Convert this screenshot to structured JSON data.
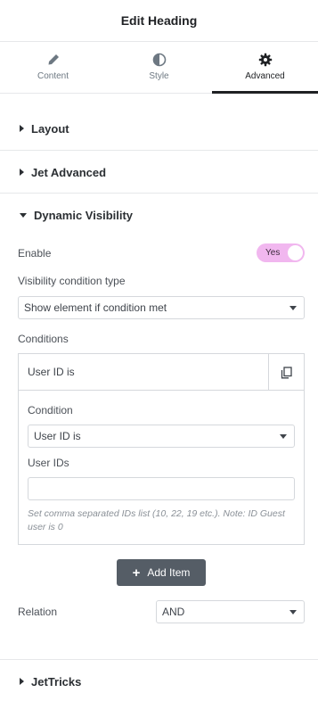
{
  "header": {
    "title": "Edit Heading"
  },
  "tabs": [
    {
      "label": "Content",
      "icon": "pencil-icon"
    },
    {
      "label": "Style",
      "icon": "half-circle-icon"
    },
    {
      "label": "Advanced",
      "icon": "gear-icon",
      "active": true
    }
  ],
  "sections": {
    "layout": "Layout",
    "jet_advanced": "Jet Advanced",
    "dynamic_visibility": "Dynamic Visibility",
    "jettricks": "JetTricks"
  },
  "dynamic_visibility": {
    "enable_label": "Enable",
    "enable_value": "Yes",
    "condition_type_label": "Visibility condition type",
    "condition_type_value": "Show element if condition met",
    "conditions_label": "Conditions",
    "item": {
      "title": "User ID is",
      "condition_label": "Condition",
      "condition_value": "User ID is",
      "user_ids_label": "User IDs",
      "user_ids_value": "",
      "description": "Set comma separated IDs list (10, 22, 19 etc.). Note: ID Guest user is 0"
    },
    "add_item_label": "Add Item",
    "relation_label": "Relation",
    "relation_value": "AND"
  },
  "colors": {
    "toggle_on": "#f1b7ef",
    "add_button": "#555d66",
    "active_tab": "#1f2124"
  }
}
